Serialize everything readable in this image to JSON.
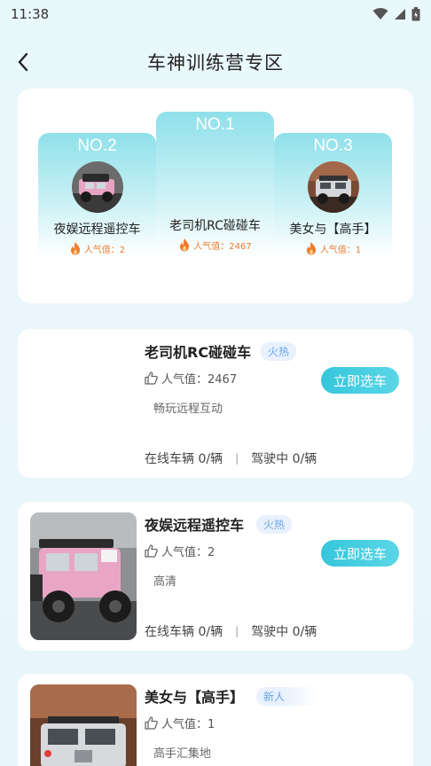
{
  "status": {
    "time": "11:38"
  },
  "header": {
    "title": "车神训练营专区"
  },
  "podium": [
    {
      "rank": "NO.2",
      "name": "夜娱远程遥控车",
      "popularity": "人气值：2"
    },
    {
      "rank": "NO.1",
      "name": "老司机RC碰碰车",
      "popularity": "人气值：2467"
    },
    {
      "rank": "NO.3",
      "name": "美女与【高手】",
      "popularity": "人气值：1"
    }
  ],
  "cars": [
    {
      "name": "老司机RC碰碰车",
      "tag": "火热",
      "popularity": "人气值：2467",
      "desc": "畅玩远程互动",
      "online": "在线车辆 0/辆",
      "driving": "驾驶中 0/辆",
      "button": "立即选车"
    },
    {
      "name": "夜娱远程遥控车",
      "tag": "火热",
      "popularity": "人气值：2",
      "desc": "高清",
      "online": "在线车辆 0/辆",
      "driving": "驾驶中 0/辆",
      "button": "立即选车"
    },
    {
      "name": "美女与【高手】",
      "tag": "新人",
      "popularity": "人气值：1",
      "desc": "高手汇集地"
    }
  ],
  "colors": {
    "accent": "#3cc8dd",
    "flame": "#ef7a2a",
    "tag": "#6aa6ea"
  }
}
